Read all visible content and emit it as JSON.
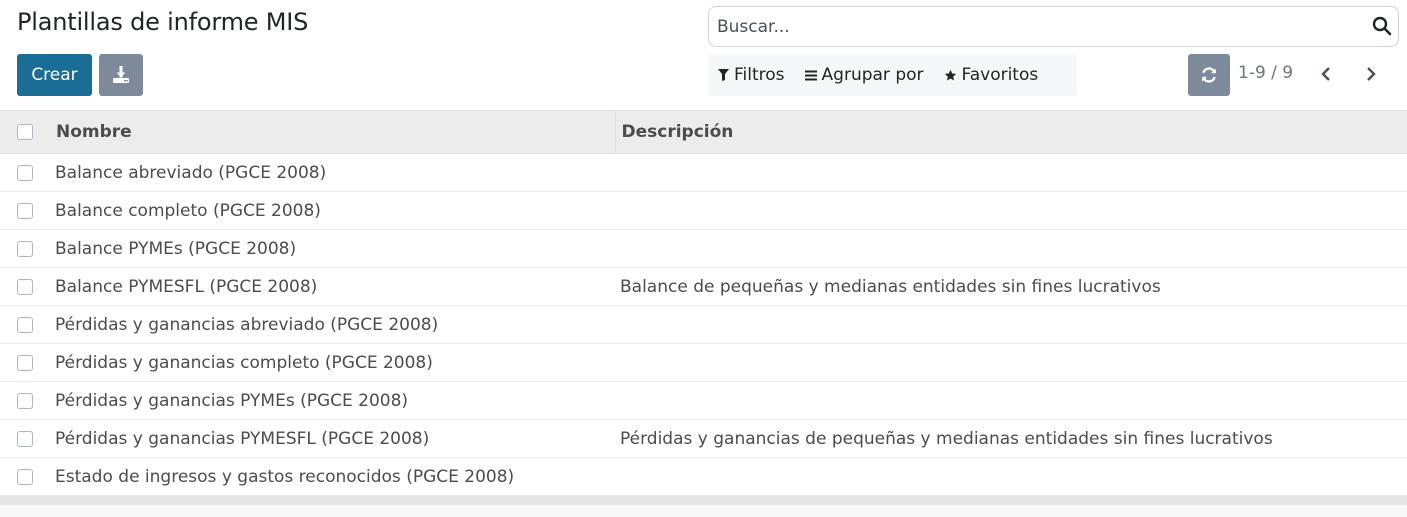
{
  "page": {
    "title": "Plantillas de informe MIS"
  },
  "search": {
    "placeholder": "Buscar...",
    "icon": "search-icon"
  },
  "toolbar": {
    "create_label": "Crear",
    "download_icon": "download-icon"
  },
  "filters": {
    "filters_label": "Filtros",
    "group_label": "Agrupar por",
    "favorites_label": "Favoritos"
  },
  "pager": {
    "value": "1-9 / 9"
  },
  "table": {
    "headers": {
      "name": "Nombre",
      "description": "Descripción"
    },
    "rows": [
      {
        "name": "Balance abreviado (PGCE 2008)",
        "description": ""
      },
      {
        "name": "Balance completo (PGCE 2008)",
        "description": ""
      },
      {
        "name": "Balance PYMEs (PGCE 2008)",
        "description": ""
      },
      {
        "name": "Balance PYMESFL (PGCE 2008)",
        "description": "Balance de pequeñas y medianas entidades sin fines lucrativos"
      },
      {
        "name": "Pérdidas y ganancias abreviado (PGCE 2008)",
        "description": ""
      },
      {
        "name": "Pérdidas y ganancias completo (PGCE 2008)",
        "description": ""
      },
      {
        "name": "Pérdidas y ganancias PYMEs (PGCE 2008)",
        "description": ""
      },
      {
        "name": "Pérdidas y ganancias PYMESFL (PGCE 2008)",
        "description": "Pérdidas y ganancias de pequeñas y medianas entidades sin fines lucrativos"
      },
      {
        "name": "Estado de ingresos y gastos reconocidos (PGCE 2008)",
        "description": ""
      }
    ]
  },
  "colors": {
    "primary": "#1a6e96",
    "secondary": "#7d8a9b",
    "header_bg": "#ececec"
  }
}
